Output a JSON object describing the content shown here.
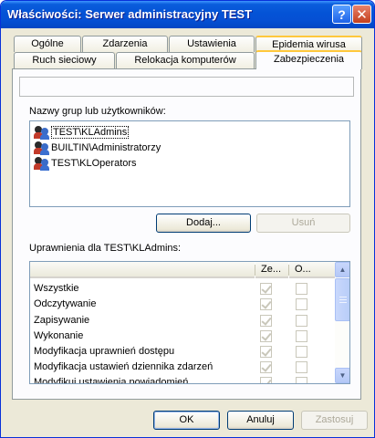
{
  "window": {
    "title": "Właściwości: Serwer administracyjny TEST"
  },
  "titlebar_buttons": {
    "help": "?",
    "close": "✕"
  },
  "tabs_row1": [
    "Ogólne",
    "Zdarzenia",
    "Ustawienia",
    "Epidemia wirusa"
  ],
  "tabs_row2": [
    "Ruch sieciowy",
    "Relokacja komputerów",
    "Zabezpieczenia"
  ],
  "active_tab": "Zabezpieczenia",
  "security": {
    "groups_label": "Nazwy grup lub użytkowników:",
    "groups": [
      {
        "name": "TEST\\KLAdmins",
        "selected": true
      },
      {
        "name": "BUILTIN\\Administratorzy",
        "selected": false
      },
      {
        "name": "TEST\\KLOperators",
        "selected": false
      }
    ],
    "add_label": "Dodaj...",
    "remove_label": "Usuń",
    "permissions_label": "Uprawnienia dla TEST\\KLAdmins:",
    "columns": {
      "allow": "Ze...",
      "deny": "O..."
    },
    "permissions": [
      {
        "name": "Wszystkie",
        "allow": true,
        "deny": false
      },
      {
        "name": "Odczytywanie",
        "allow": true,
        "deny": false
      },
      {
        "name": "Zapisywanie",
        "allow": true,
        "deny": false
      },
      {
        "name": "Wykonanie",
        "allow": true,
        "deny": false
      },
      {
        "name": "Modyfikacja uprawnień dostępu",
        "allow": true,
        "deny": false
      },
      {
        "name": "Modyfikacja ustawień dziennika zdarzeń",
        "allow": true,
        "deny": false
      },
      {
        "name": "Modyfikuj ustawienia powiadomień",
        "allow": true,
        "deny": false
      }
    ]
  },
  "footer": {
    "ok": "OK",
    "cancel": "Anuluj",
    "apply": "Zastosuj"
  }
}
